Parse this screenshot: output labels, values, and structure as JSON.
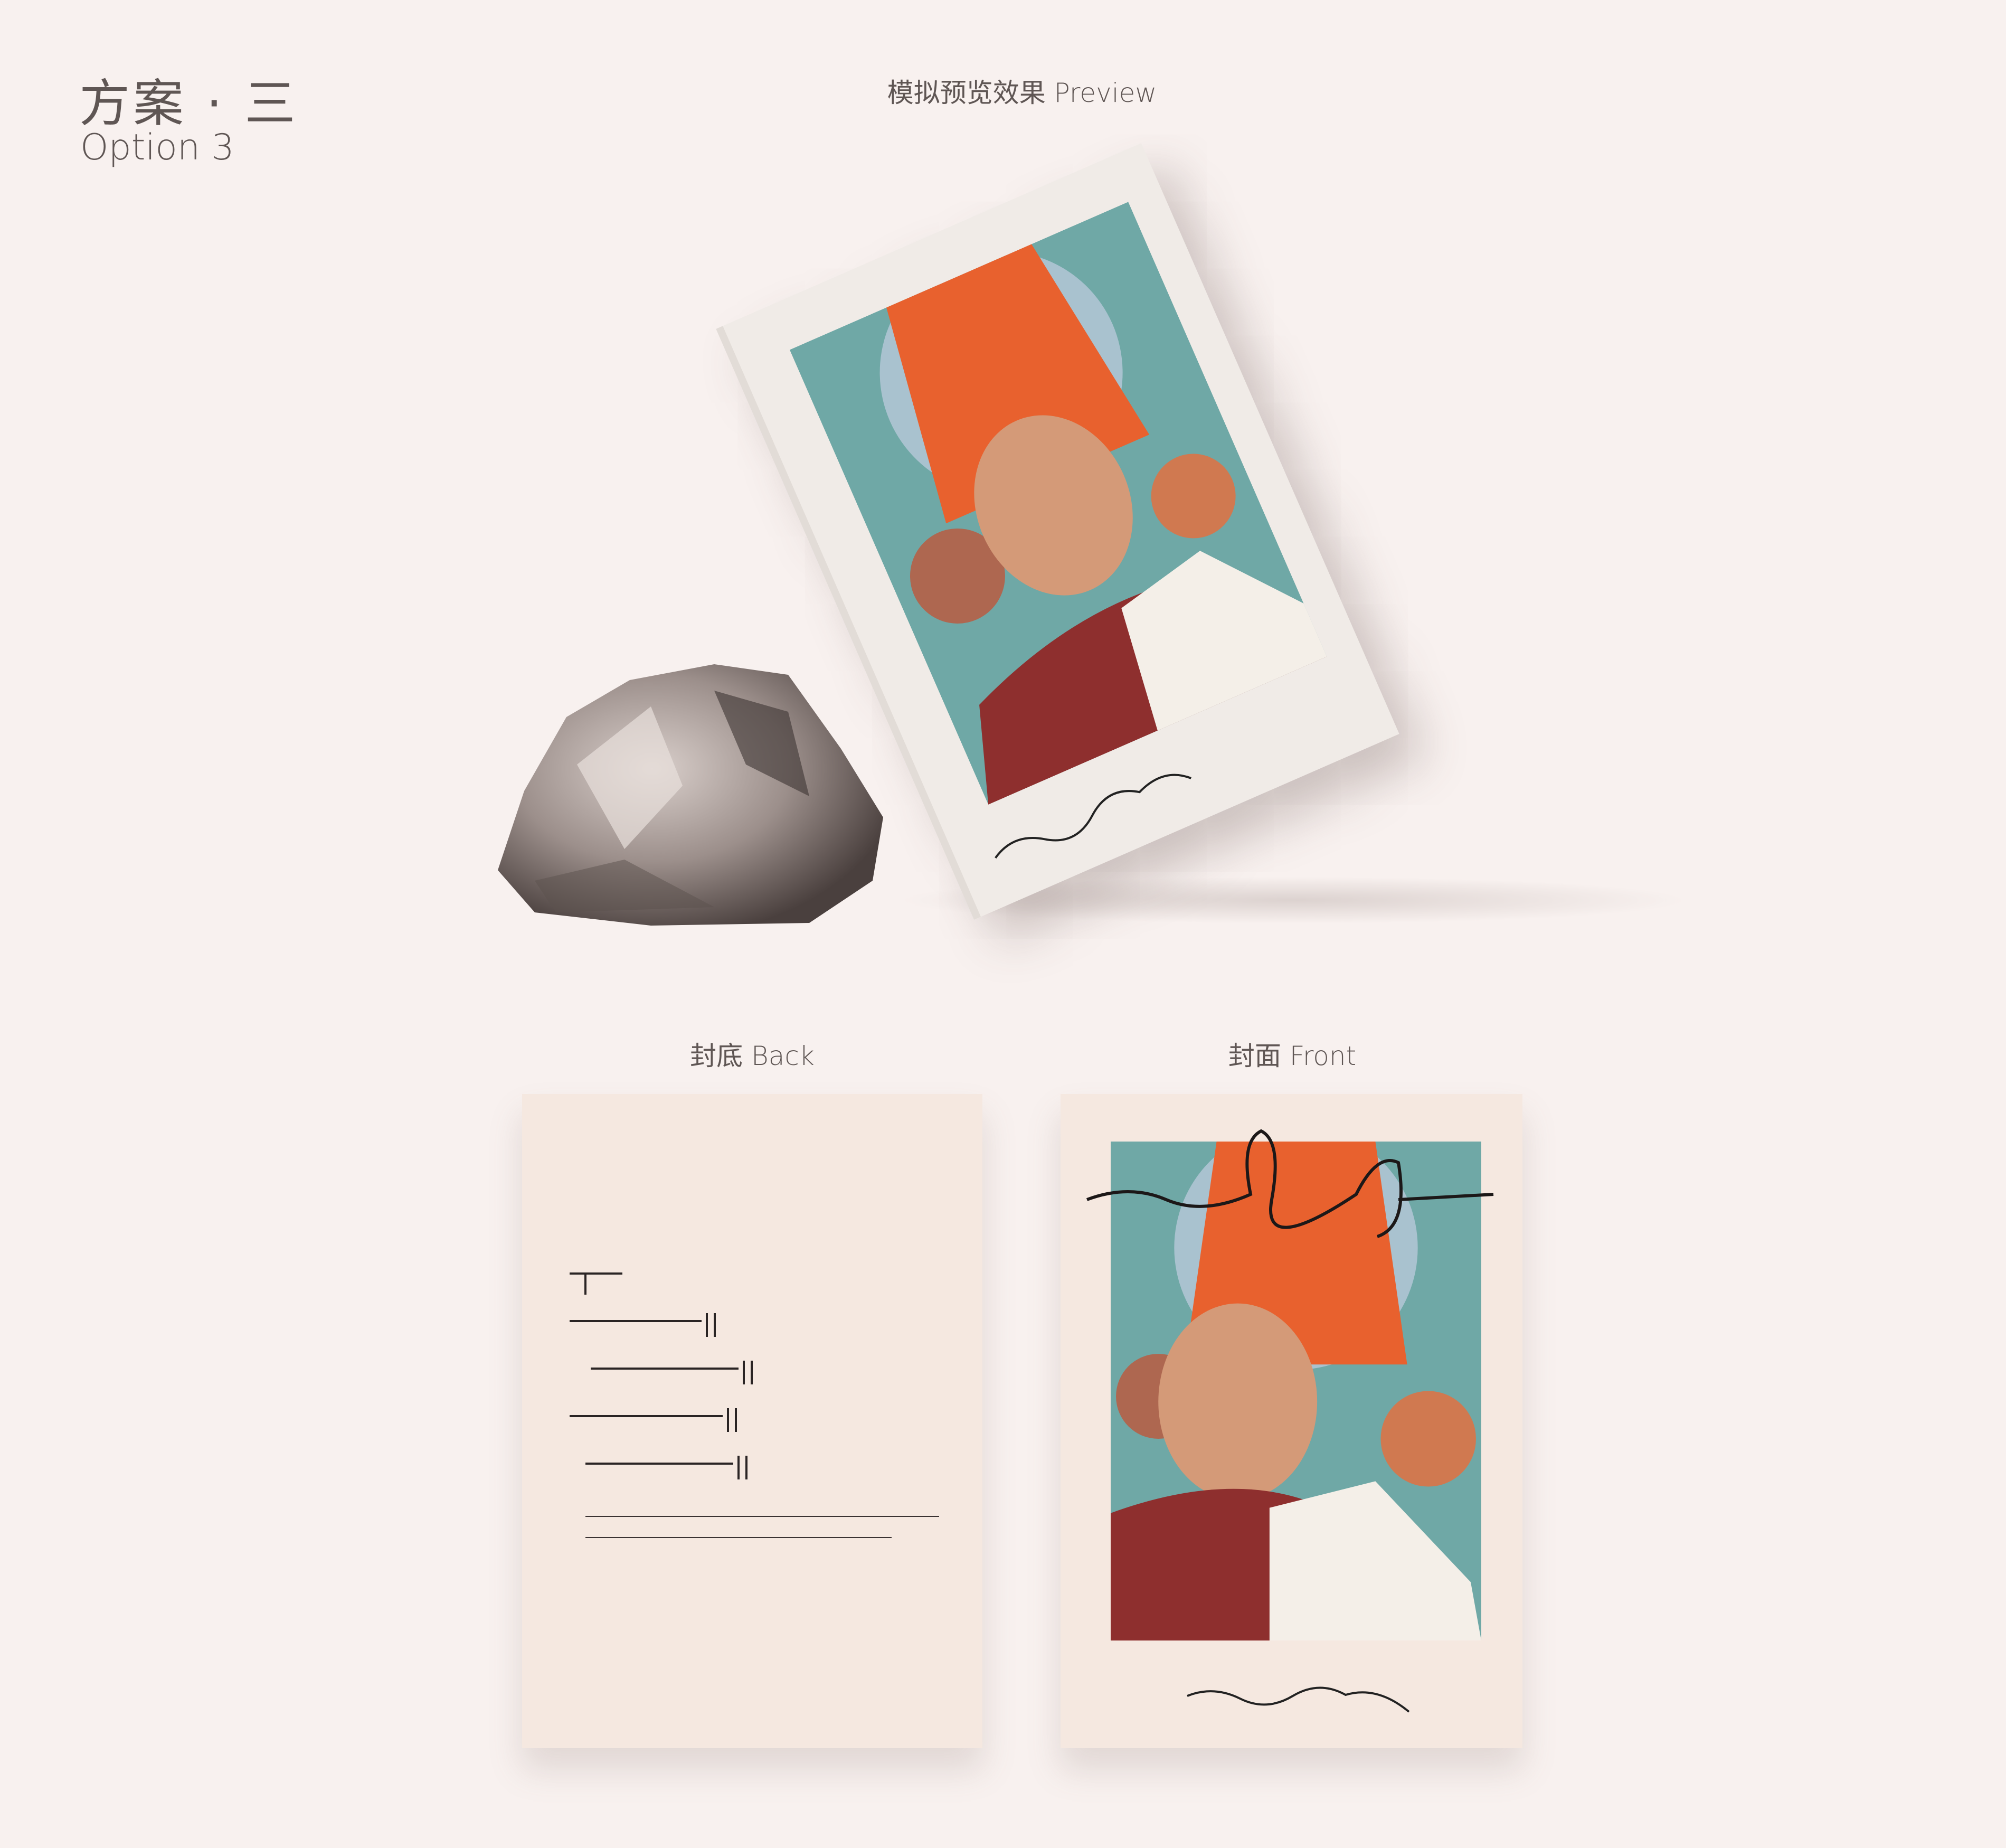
{
  "header": {
    "title": "方案 · 三",
    "subtitle": "Option 3"
  },
  "preview": {
    "label": "模拟预览效果 Preview"
  },
  "back": {
    "label": "封底 Back"
  },
  "front": {
    "label": "封面 Front"
  },
  "colors": {
    "background": "#f8f1ef",
    "card": "#f5e8e0",
    "text": "#5f5654",
    "robe": "#8e2f2e",
    "scarf": "#f4efe8"
  }
}
